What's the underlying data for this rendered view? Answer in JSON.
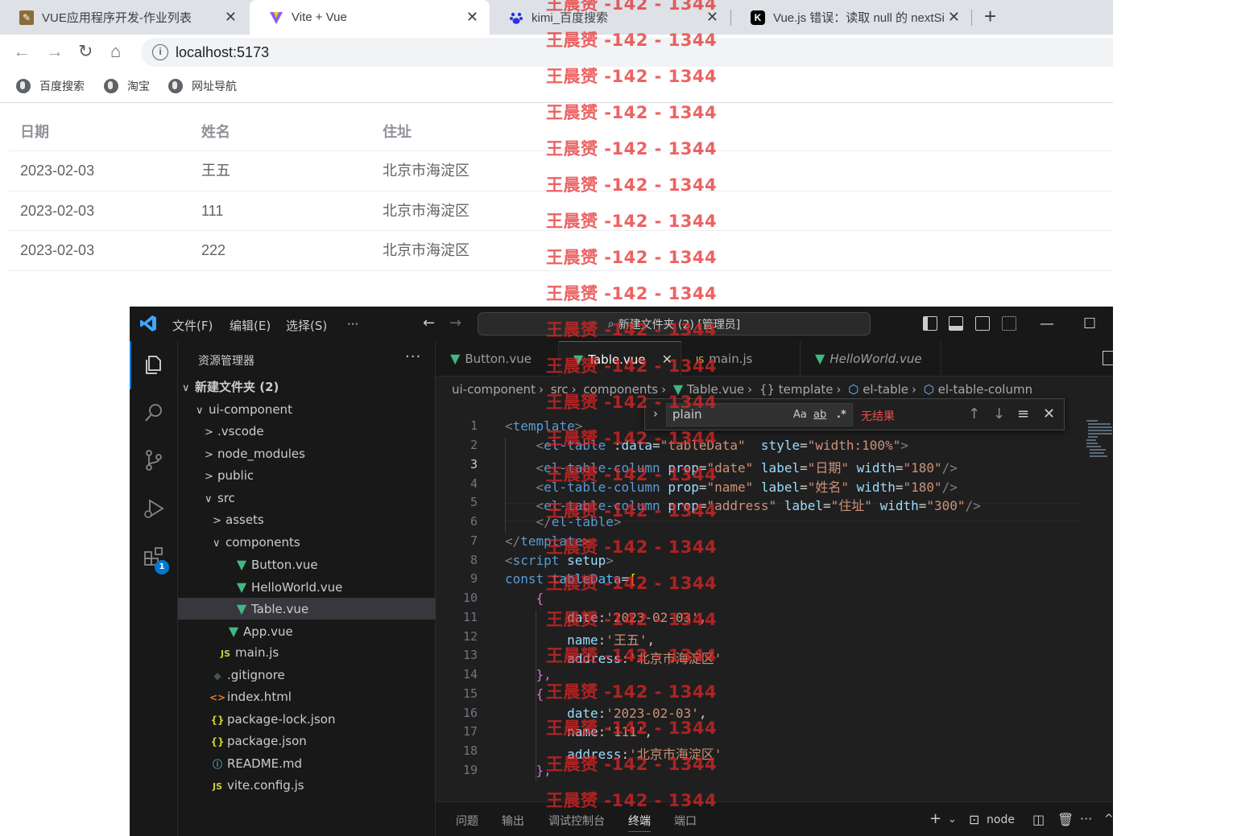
{
  "browser": {
    "tabs": [
      {
        "title": "VUE应用程序开发-作业列表",
        "icon": "tab-favicon-homework"
      },
      {
        "title": "Vite + Vue",
        "icon": "vite-icon"
      },
      {
        "title": "kimi_百度搜索",
        "icon": "baidu-icon"
      },
      {
        "title": "Vue.js 错误：读取 null 的 nextSi",
        "icon": "kimi-icon"
      }
    ],
    "url": "localhost:5173",
    "bookmarks": [
      "百度搜索",
      "淘宝",
      "网址导航"
    ]
  },
  "page_table": {
    "headers": [
      "日期",
      "姓名",
      "住址"
    ],
    "rows": [
      [
        "2023-02-03",
        "王五",
        "北京市海淀区"
      ],
      [
        "2023-02-03",
        "111",
        "北京市海淀区"
      ],
      [
        "2023-02-03",
        "222",
        "北京市海淀区"
      ]
    ]
  },
  "vscode": {
    "menu": [
      "文件(F)",
      "编辑(E)",
      "选择(S)",
      "···"
    ],
    "command_center": "新建文件夹 (2) [管理员]",
    "explorer": {
      "title": "资源管理器",
      "more": "···",
      "items": [
        {
          "label": "新建文件夹 (2)",
          "chevron": "∨",
          "icon": ""
        },
        {
          "label": "ui-component",
          "chevron": "∨",
          "icon": ""
        },
        {
          "label": ".vscode",
          "chevron": ">",
          "icon": ""
        },
        {
          "label": "node_modules",
          "chevron": ">",
          "icon": ""
        },
        {
          "label": "public",
          "chevron": ">",
          "icon": ""
        },
        {
          "label": "src",
          "chevron": "∨",
          "icon": ""
        },
        {
          "label": "assets",
          "chevron": ">",
          "icon": ""
        },
        {
          "label": "components",
          "chevron": "∨",
          "icon": ""
        },
        {
          "label": "Button.vue",
          "chevron": "",
          "icon": "vue"
        },
        {
          "label": "HelloWorld.vue",
          "chevron": "",
          "icon": "vue"
        },
        {
          "label": "Table.vue",
          "chevron": "",
          "icon": "vue"
        },
        {
          "label": "App.vue",
          "chevron": "",
          "icon": "vue"
        },
        {
          "label": "main.js",
          "chevron": "",
          "icon": "js"
        },
        {
          "label": ".gitignore",
          "chevron": "",
          "icon": "git"
        },
        {
          "label": "index.html",
          "chevron": "",
          "icon": "html"
        },
        {
          "label": "package-lock.json",
          "chevron": "",
          "icon": "json"
        },
        {
          "label": "package.json",
          "chevron": "",
          "icon": "json"
        },
        {
          "label": "README.md",
          "chevron": "",
          "icon": "md"
        },
        {
          "label": "vite.config.js",
          "chevron": "",
          "icon": "js"
        }
      ],
      "activity_badge": "1"
    },
    "editor_tabs": [
      {
        "label": "Button.vue",
        "icon": "vue"
      },
      {
        "label": "Table.vue",
        "icon": "vue"
      },
      {
        "label": "main.js",
        "icon": "js"
      },
      {
        "label": "HelloWorld.vue",
        "icon": "vue"
      }
    ],
    "breadcrumb": [
      "ui-component",
      "src",
      "components",
      "Table.vue",
      "{} template",
      "el-table",
      "el-table-column"
    ],
    "find": {
      "query": "plain",
      "opt_case": "Aa",
      "opt_word": "ab",
      "opt_regex": ".*",
      "result": "无结果"
    },
    "line_numbers": [
      "1",
      "2",
      "3",
      "4",
      "5",
      "6",
      "7",
      "8",
      "9",
      "10",
      "11",
      "12",
      "13",
      "14",
      "15",
      "16",
      "17",
      "18",
      "19"
    ],
    "code": {
      "l1_open": "<",
      "l1_tag": "template",
      "l1_close": ">",
      "l2_open": "<",
      "l2_tag": "el-table",
      "l2_attr1": ":data",
      "l2_eq1": "=",
      "l2_str1": "\"tableData\"",
      "l2_attr2": "style",
      "l2_eq2": "=",
      "l2_str2": "\"width:100%\"",
      "l2_close": ">",
      "l3_open": "<",
      "l3_tag": "el-table-column",
      "l3_a1": "prop",
      "l3_s1": "\"date\"",
      "l3_a2": "label",
      "l3_s2": "\"日期\"",
      "l3_a3": "width",
      "l3_s3": "\"180\"",
      "l3_close": "/>",
      "l4_open": "<",
      "l4_tag": "el-table-column",
      "l4_a1": "prop",
      "l4_s1": "\"name\"",
      "l4_a2": "label",
      "l4_s2": "\"姓名\"",
      "l4_a3": "width",
      "l4_s3": "\"180\"",
      "l4_close": "/>",
      "l5_open": "<",
      "l5_tag": "el-table-column",
      "l5_a1": "prop",
      "l5_s1": "\"address\"",
      "l5_a2": "label",
      "l5_s2": "\"住址\"",
      "l5_a3": "width",
      "l5_s3": "\"300\"",
      "l5_close": "/>",
      "l6_open": "</",
      "l6_tag": "el-table",
      "l6_close": ">",
      "l7_open": "</",
      "l7_tag": "template",
      "l7_close": ">",
      "l8_open": "<",
      "l8_tag": "script",
      "l8_attr": "setup",
      "l8_close": ">",
      "l9_kw": "const",
      "l9_var": "tableData",
      "l9_eq": "=",
      "l9_br": "[",
      "l10": "{",
      "l11_prop": "date",
      "l11_val": "'2023-02-03'",
      "l12_prop": "name",
      "l12_val": "'王五'",
      "l13_prop": "address",
      "l13_val": "'北京市海淀区'",
      "l14": "},",
      "l15": "{",
      "l16_prop": "date",
      "l16_val": "'2023-02-03'",
      "l17_prop": "name",
      "l17_val": "'111'",
      "l18_prop": "address",
      "l18_val": "'北京市海淀区'",
      "l19": "},"
    },
    "panel_tabs": [
      "问题",
      "输出",
      "调试控制台",
      "终端",
      "端口"
    ],
    "terminal_label": "node"
  },
  "watermark": "王晨赟 -142 - 1344",
  "colors": {
    "accent": "#0078d4",
    "vue_green": "#41b883",
    "watermark": "#e62626",
    "tab_bg": "#dee1e6"
  }
}
